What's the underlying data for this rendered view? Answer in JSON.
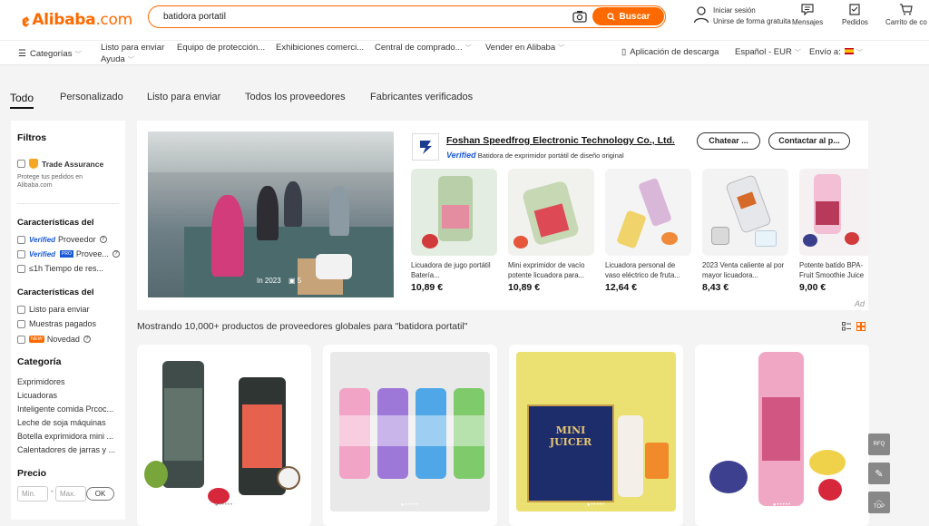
{
  "header": {
    "logo_text": "Alibaba",
    "logo_suffix": ".com",
    "search_value": "batidora portatil",
    "search_button": "Buscar",
    "signin_line1": "Iniciar sesión",
    "signin_line2": "Unirse de forma gratuita",
    "messages": "Mensajes",
    "orders": "Pedidos",
    "cart": "Carrito de co"
  },
  "nav": {
    "categories": "Categorías",
    "items": [
      "Listo para enviar",
      "Equipo de protección...",
      "Exhibiciones comerci...",
      "Central de comprado...",
      "Vender en Alibaba"
    ],
    "help": "Ayuda",
    "app_download": "Aplicación de descarga",
    "language": "Español - EUR",
    "ship_to": "Envío a:"
  },
  "tabs": [
    "Todo",
    "Personalizado",
    "Listo para enviar",
    "Todos los proveedores",
    "Fabricantes verificados"
  ],
  "sidebar": {
    "filters": "Filtros",
    "trade_assurance": "Trade Assurance",
    "trade_desc_1": "Protege tus pedidos en",
    "trade_desc_2": "Alibaba.com",
    "supplier_title": "Características del",
    "verified_badge": "Verified",
    "pro_badge": "PRO",
    "supplier_verified": "Proveedor",
    "supplier_pro": "Provee...",
    "response_time": "≤1h Tiempo de res...",
    "product_title": "Características del",
    "ready_to_ship": "Listo para enviar",
    "paid_samples": "Muestras pagados",
    "new_badge": "NEW",
    "new_label": "Novedad",
    "category_title": "Categoría",
    "categories": [
      "Exprimidores",
      "Licuadoras",
      "Inteligente comida Prcoc...",
      "Leche de soja máquinas",
      "Botella exprimidora mini ...",
      "Calentadores de jarras y ..."
    ],
    "price_title": "Precio",
    "min_placeholder": "Min.",
    "max_placeholder": "Max.",
    "ok": "OK"
  },
  "ad": {
    "video_label": "In 2023",
    "video_count": "5",
    "supplier_name": "Foshan Speedfrog Electronic Technology Co., Ltd.",
    "verified": "Verified",
    "verified_desc": "Batidora de exprimidor portátil de diseño original",
    "chat_button": "Chatear ...",
    "contact_button": "Contactar al p...",
    "ad_tag": "Ad",
    "products": [
      {
        "title": "Licuadora de jugo portátil Batería...",
        "price": "10,89 €"
      },
      {
        "title": "Mini exprimidor de vacío potente licuadora para...",
        "price": "10,89 €"
      },
      {
        "title": "Licuadora personal de vaso eléctrico de fruta...",
        "price": "12,64 €"
      },
      {
        "title": "2023 Venta caliente al por mayor licuadora...",
        "price": "8,43 €"
      },
      {
        "title": "Potente batido BPA-Fruit Smoothie Juice",
        "price": "9,00 €"
      }
    ]
  },
  "results_text": "Mostrando 10,000+ productos de proveedores globales para \"batidora portatil\"",
  "card_box_text": "MINI JUICER",
  "float": {
    "rfq": "RFQ",
    "top": "TOP"
  },
  "colors": {
    "accent": "#ff6a00",
    "verified_blue": "#1a5ad6"
  }
}
